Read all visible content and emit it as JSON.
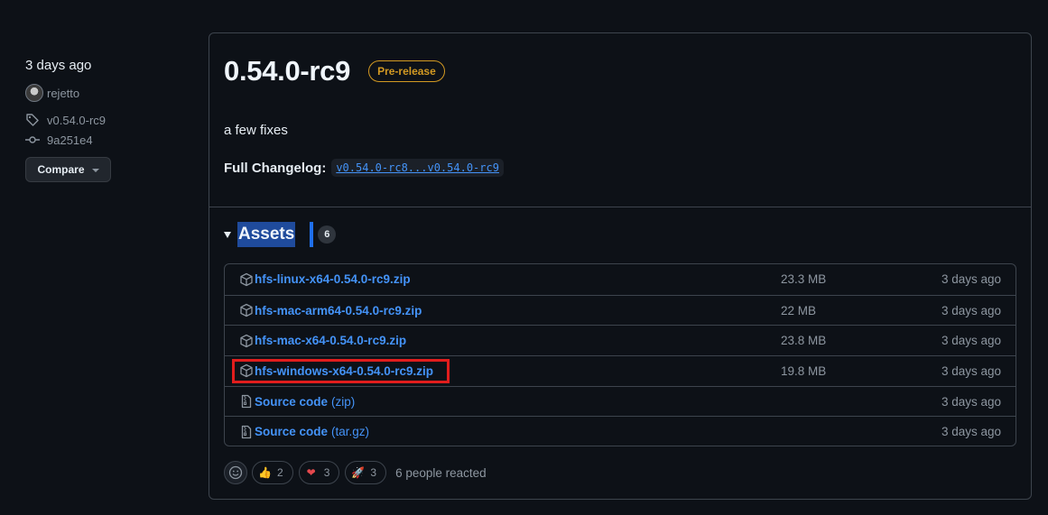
{
  "sidebar": {
    "date": "3 days ago",
    "author": "rejetto",
    "tag": "v0.54.0-rc9",
    "commit": "9a251e4",
    "compare_label": "Compare"
  },
  "release": {
    "title": "0.54.0-rc9",
    "badge": "Pre-release",
    "description": "a few fixes",
    "changelog_label": "Full Changelog:",
    "changelog_link": "v0.54.0-rc8...v0.54.0-rc9"
  },
  "assets": {
    "label": "Assets",
    "count": "6",
    "items": [
      {
        "name": "hfs-linux-x64-0.54.0-rc9.zip",
        "suffix": "",
        "size": "23.3 MB",
        "date": "3 days ago",
        "icon": "package-icon"
      },
      {
        "name": "hfs-mac-arm64-0.54.0-rc9.zip",
        "suffix": "",
        "size": "22 MB",
        "date": "3 days ago",
        "icon": "package-icon"
      },
      {
        "name": "hfs-mac-x64-0.54.0-rc9.zip",
        "suffix": "",
        "size": "23.8 MB",
        "date": "3 days ago",
        "icon": "package-icon"
      },
      {
        "name": "hfs-windows-x64-0.54.0-rc9.zip",
        "suffix": "",
        "size": "19.8 MB",
        "date": "3 days ago",
        "icon": "package-icon"
      },
      {
        "name": "Source code",
        "suffix": "(zip)",
        "size": "",
        "date": "3 days ago",
        "icon": "file-zip-icon"
      },
      {
        "name": "Source code",
        "suffix": "(tar.gz)",
        "size": "",
        "date": "3 days ago",
        "icon": "file-zip-icon"
      }
    ]
  },
  "reactions": {
    "items": [
      {
        "emoji": "👍",
        "count": "2",
        "icon": "thumbs-up-icon"
      },
      {
        "emoji": "❤",
        "count": "3",
        "icon": "heart-icon"
      },
      {
        "emoji": "🚀",
        "count": "3",
        "icon": "rocket-icon"
      }
    ],
    "summary": "6 people reacted"
  },
  "colors": {
    "background": "#0d1117",
    "link": "#4493f8",
    "prerelease": "#d29922",
    "highlight_box": "#e11d1d"
  }
}
